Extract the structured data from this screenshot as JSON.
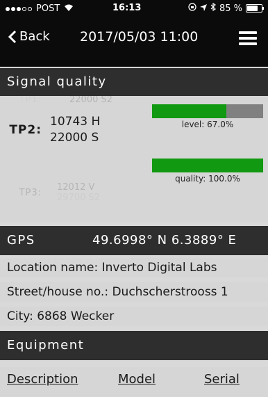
{
  "status_bar": {
    "carrier": "POST",
    "time": "16:13",
    "battery": "85 %",
    "battery_level": 0.85
  },
  "nav": {
    "back_label": "Back",
    "title": "2017/05/03 11:00"
  },
  "signal_quality": {
    "header": "Signal quality",
    "tp1": {
      "label": "TP1:",
      "line2": "22000 S2"
    },
    "tp2": {
      "label": "TP2:",
      "line1": "10743 H",
      "line2": "22000 S"
    },
    "tp3": {
      "label": "TP3:",
      "line1": "12012 V",
      "line2": "29700 S2"
    },
    "level": {
      "label": "level: 67.0%",
      "value": 0.67
    },
    "quality": {
      "label": "quality: 100.0%",
      "value": 1.0
    }
  },
  "gps": {
    "label": "GPS",
    "coords": "49.6998° N 6.3889° E"
  },
  "location": {
    "name": "Location name:  Inverto Digital Labs",
    "street": "Street/house no.:  Duchscherstrooss 1",
    "city": "City:  6868 Wecker"
  },
  "equipment": {
    "header": "Equipment",
    "columns": [
      "Description",
      "Model",
      "Serial"
    ]
  }
}
